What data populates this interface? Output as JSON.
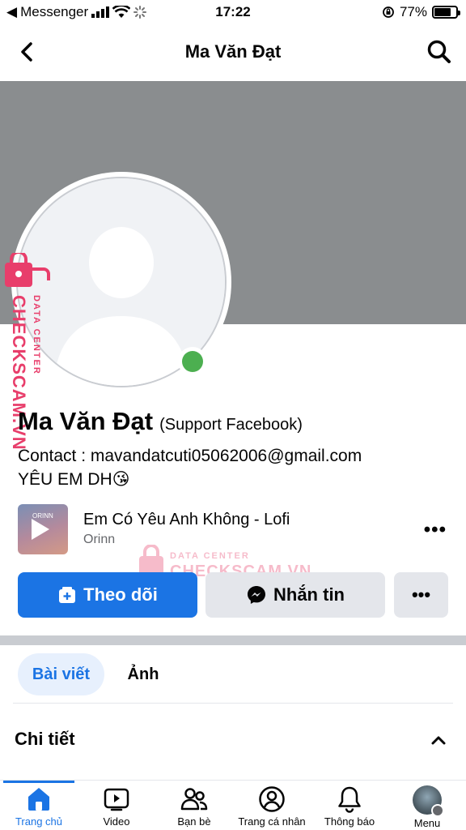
{
  "status_bar": {
    "carrier": "Messenger",
    "time": "17:22",
    "battery": "77%",
    "battery_level": 0.77
  },
  "nav": {
    "title": "Ma Văn Đạt"
  },
  "profile": {
    "name": "Ma Văn Đạt",
    "note": "(Support Facebook)",
    "bio_line_1": "Contact : mavandatcuti05062006@gmail.com",
    "bio_line_2": "YÊU EM DH😘"
  },
  "watermark": {
    "brand": "CHECKSCAM.VN",
    "sub": "DATA CENTER"
  },
  "music": {
    "thumb_text": "ORINN",
    "song": "Em Có Yêu Anh Không - Lofi",
    "artist": "Orinn"
  },
  "actions": {
    "follow": "Theo dõi",
    "message": "Nhắn tin",
    "more": "•••"
  },
  "tabs": [
    {
      "label": "Bài viết"
    },
    {
      "label": "Ảnh"
    }
  ],
  "details": {
    "title": "Chi tiết"
  },
  "tabbar": [
    {
      "label": "Trang chủ",
      "icon": "home-icon"
    },
    {
      "label": "Video",
      "icon": "video-icon"
    },
    {
      "label": "Bạn bè",
      "icon": "friends-icon"
    },
    {
      "label": "Trang cá nhân",
      "icon": "profile-icon"
    },
    {
      "label": "Thông báo",
      "icon": "bell-icon"
    },
    {
      "label": "Menu",
      "icon": "menu-avatar"
    }
  ],
  "colors": {
    "accent": "#1b74e4",
    "online": "#4caf50",
    "watermark": "#e83e6b",
    "cover": "#8a8d8f"
  }
}
